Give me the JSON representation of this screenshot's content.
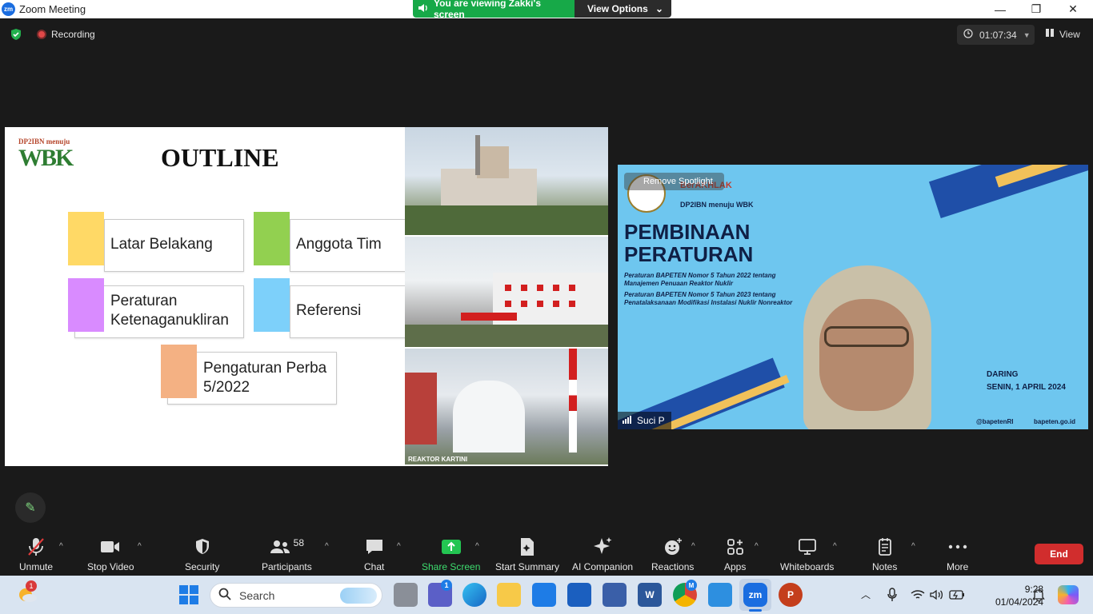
{
  "window": {
    "app_logo": "zm",
    "title": "Zoom Meeting"
  },
  "banner": {
    "viewing_text": "You are viewing Zakki's screen",
    "view_options": "View Options"
  },
  "meeting": {
    "recording_label": "Recording",
    "timer": "01:07:34",
    "view_label": "View"
  },
  "slide": {
    "wbk_caption": "DP2IBN menuju",
    "wbk_logo": "WBK",
    "title": "OUTLINE",
    "items": [
      {
        "label": "Latar Belakang",
        "color": "#FFD966"
      },
      {
        "label": "Anggota Tim",
        "color": "#92D050"
      },
      {
        "label": "Peraturan Ketenaganukliran",
        "color": "#D98BFF"
      },
      {
        "label": "Referensi",
        "color": "#7DD0FA"
      },
      {
        "label": "Pengaturan Perba 5/2022",
        "color": "#F4B183"
      }
    ],
    "photo_caption": "REAKTOR KARTINI"
  },
  "video": {
    "spotlight_label": "Remove Spotlight",
    "berakhlak": "BerAKHLAK",
    "org_line": "DP2IBN menuju WBK",
    "heading_1": "PEMBINAAN",
    "heading_2": "PERATURAN",
    "reg_1a": "Peraturan  BAPETEN  Nomor  5  Tahun  2022  tentang",
    "reg_1b": "Manajemen Penuaan Reaktor Nuklir",
    "reg_2a": "Peraturan  BAPETEN  Nomor  5  Tahun  2023  tentang",
    "reg_2b": "Penatalaksanaan Modifikasi Instalasi Nuklir Nonreaktor",
    "mode": "DARING",
    "date": "SENIN, 1 APRIL 2024",
    "social": "@bapetenRI",
    "website": "bapeten.go.id",
    "speaker_name": "Suci P"
  },
  "toolbar": {
    "unmute": "Unmute",
    "stop_video": "Stop Video",
    "security": "Security",
    "participants": "Participants",
    "participants_count": "58",
    "chat": "Chat",
    "share_screen": "Share Screen",
    "start_summary": "Start Summary",
    "ai_companion": "AI Companion",
    "reactions": "Reactions",
    "apps": "Apps",
    "whiteboards": "Whiteboards",
    "notes": "Notes",
    "more": "More",
    "end": "End"
  },
  "taskbar": {
    "weather_badge": "1",
    "search_placeholder": "Search",
    "teams_badge": "1",
    "chrome_badge": "M",
    "zoom_logo": "zm",
    "time": "9:28",
    "date": "01/04/2024"
  },
  "colors": {
    "accent_green": "#17a948",
    "end_red": "#d12d2d",
    "video_bg": "#6ec6ef"
  }
}
